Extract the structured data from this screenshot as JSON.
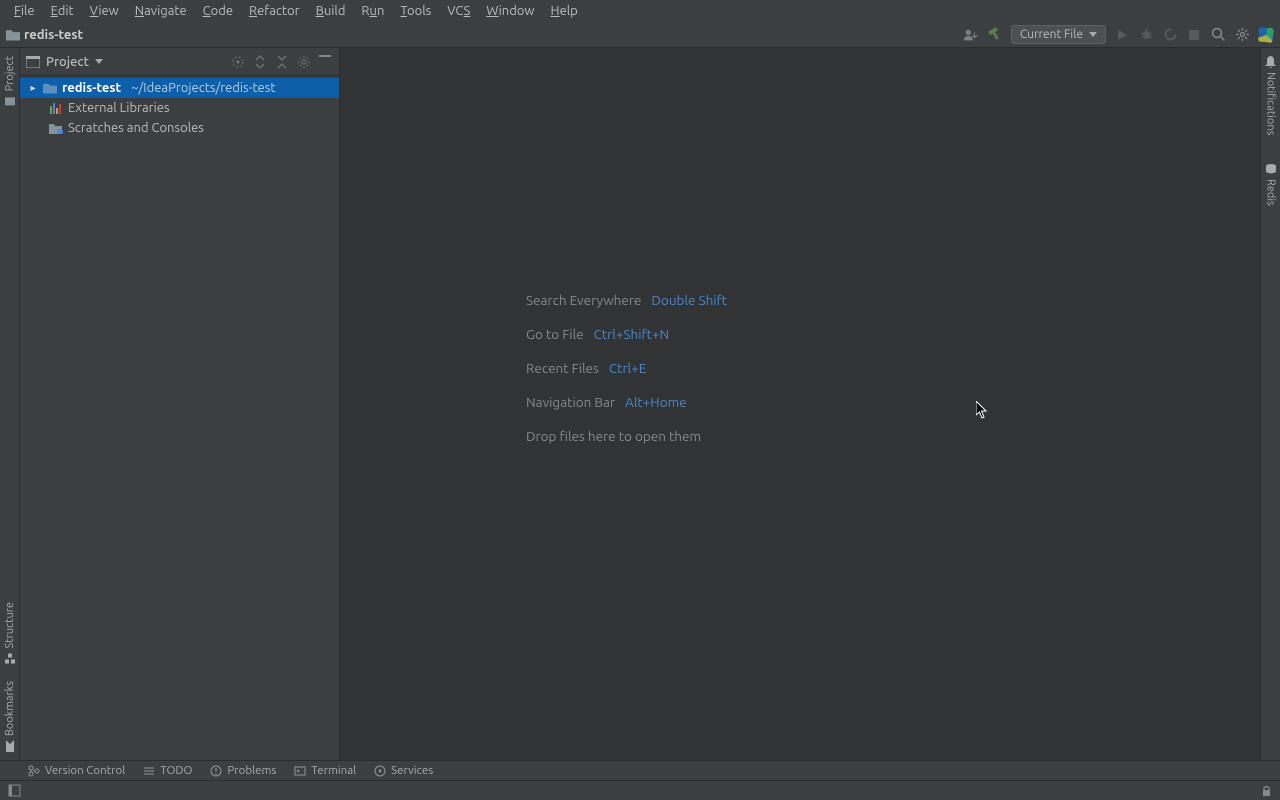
{
  "menu": {
    "items": [
      {
        "u": "F",
        "rest": "ile"
      },
      {
        "u": "E",
        "rest": "dit"
      },
      {
        "u": "V",
        "rest": "iew"
      },
      {
        "u": "N",
        "rest": "avigate"
      },
      {
        "u": "C",
        "rest": "ode"
      },
      {
        "u": "R",
        "rest": "efactor"
      },
      {
        "u": "B",
        "rest": "uild"
      },
      {
        "u": "R",
        "rest": "un",
        "pre": "R"
      },
      {
        "u": "T",
        "rest": "ools"
      },
      {
        "u": "",
        "rest": "VCS",
        "plain": "VCS",
        "uidx": 2
      },
      {
        "u": "W",
        "rest": "indow"
      },
      {
        "u": "H",
        "rest": "elp"
      }
    ],
    "file": "File",
    "edit": "Edit",
    "view": "View",
    "navigate": "Navigate",
    "code": "Code",
    "refactor": "Refactor",
    "build": "Build",
    "run": "Run",
    "tools": "Tools",
    "vcs": "VCS",
    "window": "Window",
    "help": "Help"
  },
  "breadcrumb": {
    "project": "redis-test"
  },
  "run_config": {
    "label": "Current File"
  },
  "project_panel": {
    "title": "Project",
    "root_name": "redis-test",
    "root_path": "~/IdeaProjects/redis-test",
    "external_libs": "External Libraries",
    "scratches": "Scratches and Consoles"
  },
  "hints": {
    "search": {
      "label": "Search Everywhere",
      "key": "Double Shift"
    },
    "gotofile": {
      "label": "Go to File",
      "key": "Ctrl+Shift+N"
    },
    "recent": {
      "label": "Recent Files",
      "key": "Ctrl+E"
    },
    "navbar": {
      "label": "Navigation Bar",
      "key": "Alt+Home"
    },
    "drop": {
      "label": "Drop files here to open them"
    }
  },
  "left_tabs": {
    "project": "Project",
    "structure": "Structure",
    "bookmarks": "Bookmarks"
  },
  "right_tabs": {
    "notifications": "Notifications",
    "redis": "Redis"
  },
  "bottom_tabs": {
    "version_control": "Version Control",
    "todo": "TODO",
    "problems": "Problems",
    "terminal": "Terminal",
    "services": "Services"
  }
}
